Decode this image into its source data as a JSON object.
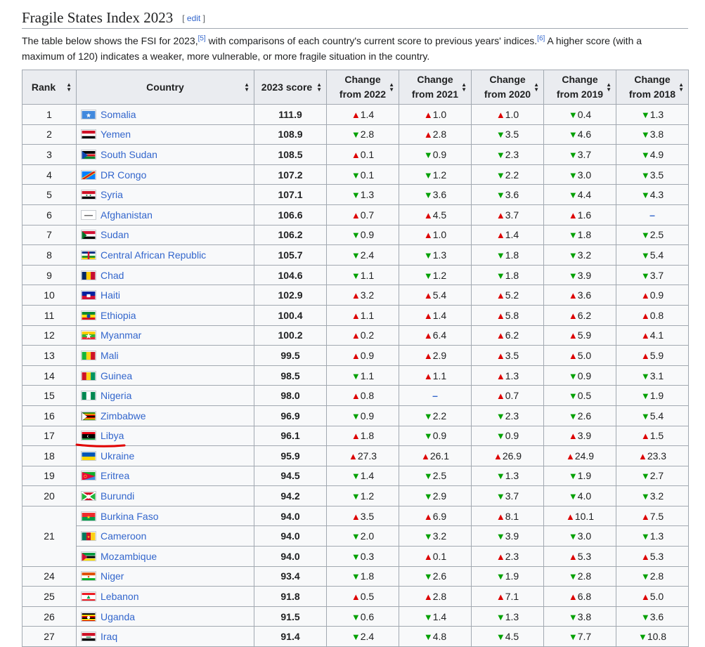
{
  "section": {
    "title": "Fragile States Index 2023",
    "edit_open": "[",
    "edit_label": "edit",
    "edit_close": "]",
    "intro_part1": "The table below shows the FSI for 2023,",
    "ref1": "[5]",
    "intro_part2": " with comparisons of each country's current score to previous years' indices.",
    "ref2": "[6]",
    "intro_part3": " A higher score (with a maximum of 120) indicates a weaker, more vulnerable, or more fragile situation in the country."
  },
  "table": {
    "headers": {
      "rank": "Rank",
      "country": "Country",
      "score": "2023 score",
      "c2022": "Change from 2022",
      "c2021": "Change from 2021",
      "c2020": "Change from 2020",
      "c2019": "Change from 2019",
      "c2018": "Change from 2018"
    },
    "rows": [
      {
        "rank": "1",
        "country": "Somalia",
        "score": "111.9",
        "flag": "somalia",
        "changes": [
          [
            "up",
            "1.4"
          ],
          [
            "up",
            "1.0"
          ],
          [
            "up",
            "1.0"
          ],
          [
            "down",
            "0.4"
          ],
          [
            "down",
            "1.3"
          ]
        ]
      },
      {
        "rank": "2",
        "country": "Yemen",
        "score": "108.9",
        "flag": "yemen",
        "changes": [
          [
            "down",
            "2.8"
          ],
          [
            "up",
            "2.8"
          ],
          [
            "down",
            "3.5"
          ],
          [
            "down",
            "4.6"
          ],
          [
            "down",
            "3.8"
          ]
        ]
      },
      {
        "rank": "3",
        "country": "South Sudan",
        "score": "108.5",
        "flag": "southsudan",
        "changes": [
          [
            "up",
            "0.1"
          ],
          [
            "down",
            "0.9"
          ],
          [
            "down",
            "2.3"
          ],
          [
            "down",
            "3.7"
          ],
          [
            "down",
            "4.9"
          ]
        ]
      },
      {
        "rank": "4",
        "country": "DR Congo",
        "score": "107.2",
        "flag": "drc",
        "changes": [
          [
            "down",
            "0.1"
          ],
          [
            "down",
            "1.2"
          ],
          [
            "down",
            "2.2"
          ],
          [
            "down",
            "3.0"
          ],
          [
            "down",
            "3.5"
          ]
        ]
      },
      {
        "rank": "5",
        "country": "Syria",
        "score": "107.1",
        "flag": "syria",
        "changes": [
          [
            "down",
            "1.3"
          ],
          [
            "down",
            "3.6"
          ],
          [
            "down",
            "3.6"
          ],
          [
            "down",
            "4.4"
          ],
          [
            "down",
            "4.3"
          ]
        ]
      },
      {
        "rank": "6",
        "country": "Afghanistan",
        "score": "106.6",
        "flag": "afghanistan",
        "changes": [
          [
            "up",
            "0.7"
          ],
          [
            "up",
            "4.5"
          ],
          [
            "up",
            "3.7"
          ],
          [
            "up",
            "1.6"
          ],
          [
            "dash",
            ""
          ]
        ]
      },
      {
        "rank": "7",
        "country": "Sudan",
        "score": "106.2",
        "flag": "sudan",
        "changes": [
          [
            "down",
            "0.9"
          ],
          [
            "up",
            "1.0"
          ],
          [
            "up",
            "1.4"
          ],
          [
            "down",
            "1.8"
          ],
          [
            "down",
            "2.5"
          ]
        ]
      },
      {
        "rank": "8",
        "country": "Central African Republic",
        "score": "105.7",
        "flag": "car",
        "changes": [
          [
            "down",
            "2.4"
          ],
          [
            "down",
            "1.3"
          ],
          [
            "down",
            "1.8"
          ],
          [
            "down",
            "3.2"
          ],
          [
            "down",
            "5.4"
          ]
        ]
      },
      {
        "rank": "9",
        "country": "Chad",
        "score": "104.6",
        "flag": "chad",
        "changes": [
          [
            "down",
            "1.1"
          ],
          [
            "down",
            "1.2"
          ],
          [
            "down",
            "1.8"
          ],
          [
            "down",
            "3.9"
          ],
          [
            "down",
            "3.7"
          ]
        ]
      },
      {
        "rank": "10",
        "country": "Haiti",
        "score": "102.9",
        "flag": "haiti",
        "changes": [
          [
            "up",
            "3.2"
          ],
          [
            "up",
            "5.4"
          ],
          [
            "up",
            "5.2"
          ],
          [
            "up",
            "3.6"
          ],
          [
            "up",
            "0.9"
          ]
        ]
      },
      {
        "rank": "11",
        "country": "Ethiopia",
        "score": "100.4",
        "flag": "ethiopia",
        "changes": [
          [
            "up",
            "1.1"
          ],
          [
            "up",
            "1.4"
          ],
          [
            "up",
            "5.8"
          ],
          [
            "up",
            "6.2"
          ],
          [
            "up",
            "0.8"
          ]
        ]
      },
      {
        "rank": "12",
        "country": "Myanmar",
        "score": "100.2",
        "flag": "myanmar",
        "changes": [
          [
            "up",
            "0.2"
          ],
          [
            "up",
            "6.4"
          ],
          [
            "up",
            "6.2"
          ],
          [
            "up",
            "5.9"
          ],
          [
            "up",
            "4.1"
          ]
        ]
      },
      {
        "rank": "13",
        "country": "Mali",
        "score": "99.5",
        "flag": "mali",
        "changes": [
          [
            "up",
            "0.9"
          ],
          [
            "up",
            "2.9"
          ],
          [
            "up",
            "3.5"
          ],
          [
            "up",
            "5.0"
          ],
          [
            "up",
            "5.9"
          ]
        ]
      },
      {
        "rank": "14",
        "country": "Guinea",
        "score": "98.5",
        "flag": "guinea",
        "changes": [
          [
            "down",
            "1.1"
          ],
          [
            "up",
            "1.1"
          ],
          [
            "up",
            "1.3"
          ],
          [
            "down",
            "0.9"
          ],
          [
            "down",
            "3.1"
          ]
        ]
      },
      {
        "rank": "15",
        "country": "Nigeria",
        "score": "98.0",
        "flag": "nigeria",
        "changes": [
          [
            "up",
            "0.8"
          ],
          [
            "dash",
            ""
          ],
          [
            "up",
            "0.7"
          ],
          [
            "down",
            "0.5"
          ],
          [
            "down",
            "1.9"
          ]
        ]
      },
      {
        "rank": "16",
        "country": "Zimbabwe",
        "score": "96.9",
        "flag": "zimbabwe",
        "changes": [
          [
            "down",
            "0.9"
          ],
          [
            "down",
            "2.2"
          ],
          [
            "down",
            "2.3"
          ],
          [
            "down",
            "2.6"
          ],
          [
            "down",
            "5.4"
          ]
        ]
      },
      {
        "rank": "17",
        "country": "Libya",
        "score": "96.1",
        "flag": "libya",
        "changes": [
          [
            "up",
            "1.8"
          ],
          [
            "down",
            "0.9"
          ],
          [
            "down",
            "0.9"
          ],
          [
            "up",
            "3.9"
          ],
          [
            "up",
            "1.5"
          ]
        ]
      },
      {
        "rank": "18",
        "country": "Ukraine",
        "score": "95.9",
        "flag": "ukraine",
        "changes": [
          [
            "up",
            "27.3"
          ],
          [
            "up",
            "26.1"
          ],
          [
            "up",
            "26.9"
          ],
          [
            "up",
            "24.9"
          ],
          [
            "up",
            "23.3"
          ]
        ]
      },
      {
        "rank": "19",
        "country": "Eritrea",
        "score": "94.5",
        "flag": "eritrea",
        "changes": [
          [
            "down",
            "1.4"
          ],
          [
            "down",
            "2.5"
          ],
          [
            "down",
            "1.3"
          ],
          [
            "down",
            "1.9"
          ],
          [
            "down",
            "2.7"
          ]
        ]
      },
      {
        "rank": "20",
        "country": "Burundi",
        "score": "94.2",
        "flag": "burundi",
        "changes": [
          [
            "down",
            "1.2"
          ],
          [
            "down",
            "2.9"
          ],
          [
            "down",
            "3.7"
          ],
          [
            "down",
            "4.0"
          ],
          [
            "down",
            "3.2"
          ]
        ]
      },
      {
        "rank": "21",
        "country": "Burkina Faso",
        "score": "94.0",
        "flag": "burkina",
        "rowspan": 3,
        "changes": [
          [
            "up",
            "3.5"
          ],
          [
            "up",
            "6.9"
          ],
          [
            "up",
            "8.1"
          ],
          [
            "up",
            "10.1"
          ],
          [
            "up",
            "7.5"
          ]
        ]
      },
      {
        "rank": "",
        "country": "Cameroon",
        "score": "94.0",
        "flag": "cameroon",
        "skipRank": true,
        "changes": [
          [
            "down",
            "2.0"
          ],
          [
            "down",
            "3.2"
          ],
          [
            "down",
            "3.9"
          ],
          [
            "down",
            "3.0"
          ],
          [
            "down",
            "1.3"
          ]
        ]
      },
      {
        "rank": "",
        "country": "Mozambique",
        "score": "94.0",
        "flag": "mozambique",
        "skipRank": true,
        "changes": [
          [
            "down",
            "0.3"
          ],
          [
            "up",
            "0.1"
          ],
          [
            "up",
            "2.3"
          ],
          [
            "up",
            "5.3"
          ],
          [
            "up",
            "5.3"
          ]
        ]
      },
      {
        "rank": "24",
        "country": "Niger",
        "score": "93.4",
        "flag": "niger",
        "changes": [
          [
            "down",
            "1.8"
          ],
          [
            "down",
            "2.6"
          ],
          [
            "down",
            "1.9"
          ],
          [
            "down",
            "2.8"
          ],
          [
            "down",
            "2.8"
          ]
        ]
      },
      {
        "rank": "25",
        "country": "Lebanon",
        "score": "91.8",
        "flag": "lebanon",
        "changes": [
          [
            "up",
            "0.5"
          ],
          [
            "up",
            "2.8"
          ],
          [
            "up",
            "7.1"
          ],
          [
            "up",
            "6.8"
          ],
          [
            "up",
            "5.0"
          ]
        ]
      },
      {
        "rank": "26",
        "country": "Uganda",
        "score": "91.5",
        "flag": "uganda",
        "changes": [
          [
            "down",
            "0.6"
          ],
          [
            "down",
            "1.4"
          ],
          [
            "down",
            "1.3"
          ],
          [
            "down",
            "3.8"
          ],
          [
            "down",
            "3.6"
          ]
        ]
      },
      {
        "rank": "27",
        "country": "Iraq",
        "score": "91.4",
        "flag": "iraq",
        "changes": [
          [
            "down",
            "2.4"
          ],
          [
            "down",
            "4.8"
          ],
          [
            "down",
            "4.5"
          ],
          [
            "down",
            "7.7"
          ],
          [
            "down",
            "10.8"
          ]
        ]
      }
    ]
  },
  "symbols": {
    "up": "▲",
    "down": "▼",
    "dash": "–",
    "sort": "▲▼"
  },
  "colors": {
    "up": "#dd0000",
    "down": "#00a000",
    "link": "#3366cc",
    "annotation": "#e00000"
  }
}
